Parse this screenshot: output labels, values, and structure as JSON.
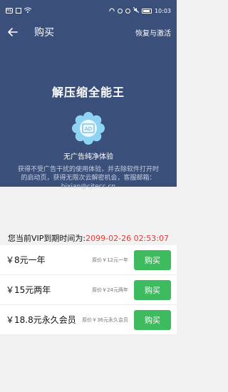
{
  "status_bar": {
    "time": "10:03",
    "left_icons": [
      "sim-icon",
      "signal-icon",
      "wifi-icon"
    ],
    "right_icons": [
      "headphones-icon",
      "eye-icon",
      "alarm-icon",
      "mute-icon",
      "battery-icon"
    ]
  },
  "header": {
    "back_icon": "arrow-left-icon",
    "title": "购买",
    "restore_label": "恢复与激活"
  },
  "hero": {
    "app_name": "解压缩全能王",
    "badge_text": "AD",
    "feature_title": "无广告纯净体验",
    "feature_desc": "获得不受广告干扰的使用体验，并去除软件打开时的启动页，获得无限次云解密机会，客服邮箱：bixian@cjtecc.cn"
  },
  "vip": {
    "prefix": "您当前VIP到期时间为:",
    "expire_time": "2099-02-26 02:53:07"
  },
  "plans": [
    {
      "name": "￥8元一年",
      "original": "原价￥12元一年",
      "buy_label": "购买"
    },
    {
      "name": "￥15元两年",
      "original": "原价￥24元两年",
      "buy_label": "购买"
    },
    {
      "name": "￥18.8元永久会员",
      "original": "原价￥36元永久会员",
      "buy_label": "购买"
    }
  ],
  "colors": {
    "hero_bg": "#3a4f7a",
    "buy_button": "#3dbb5e",
    "expire_text": "#e53935"
  }
}
